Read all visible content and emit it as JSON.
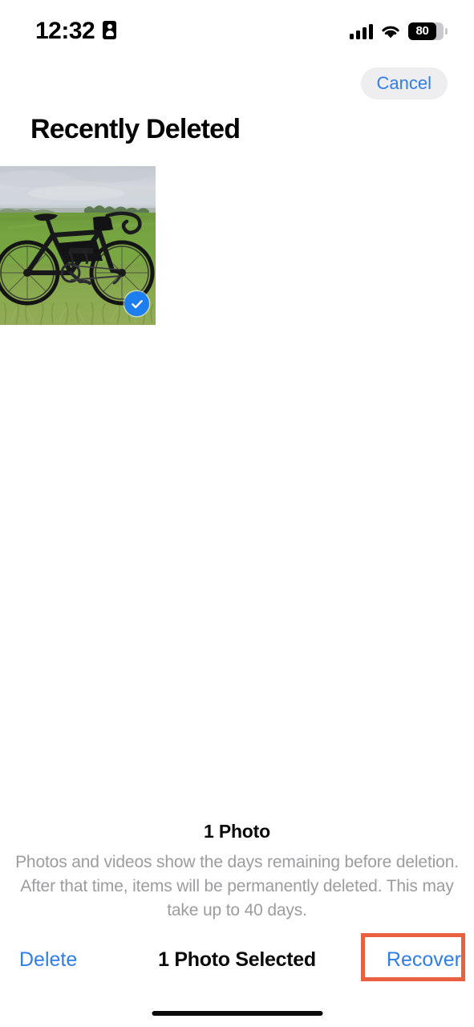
{
  "status_bar": {
    "time": "12:32",
    "lock_icon": "contact-card-icon",
    "cellular_icon": "cellular-bars-icon",
    "wifi_icon": "wifi-icon",
    "battery_level": "80",
    "battery_percent": 80
  },
  "nav": {
    "cancel_label": "Cancel",
    "title": "Recently Deleted"
  },
  "grid": {
    "photos": [
      {
        "alt": "Black gravel bicycle parked on green grass field under cloudy sky",
        "selected": true,
        "check_icon": "check-circle-icon"
      }
    ]
  },
  "footer": {
    "count_label": "1 Photo",
    "description": "Photos and videos show the days remaining before deletion. After that time, items will be permanently deleted. This may take up to 40 days."
  },
  "toolbar": {
    "delete_label": "Delete",
    "status_label": "1 Photo Selected",
    "recover_label": "Recover"
  },
  "colors": {
    "accent_blue": "#2f7ee8",
    "selection_blue": "#1d7ef0",
    "highlight_red": "#e8603f",
    "secondary_text": "#9c9c9e",
    "chip_background": "#eeeef0"
  }
}
